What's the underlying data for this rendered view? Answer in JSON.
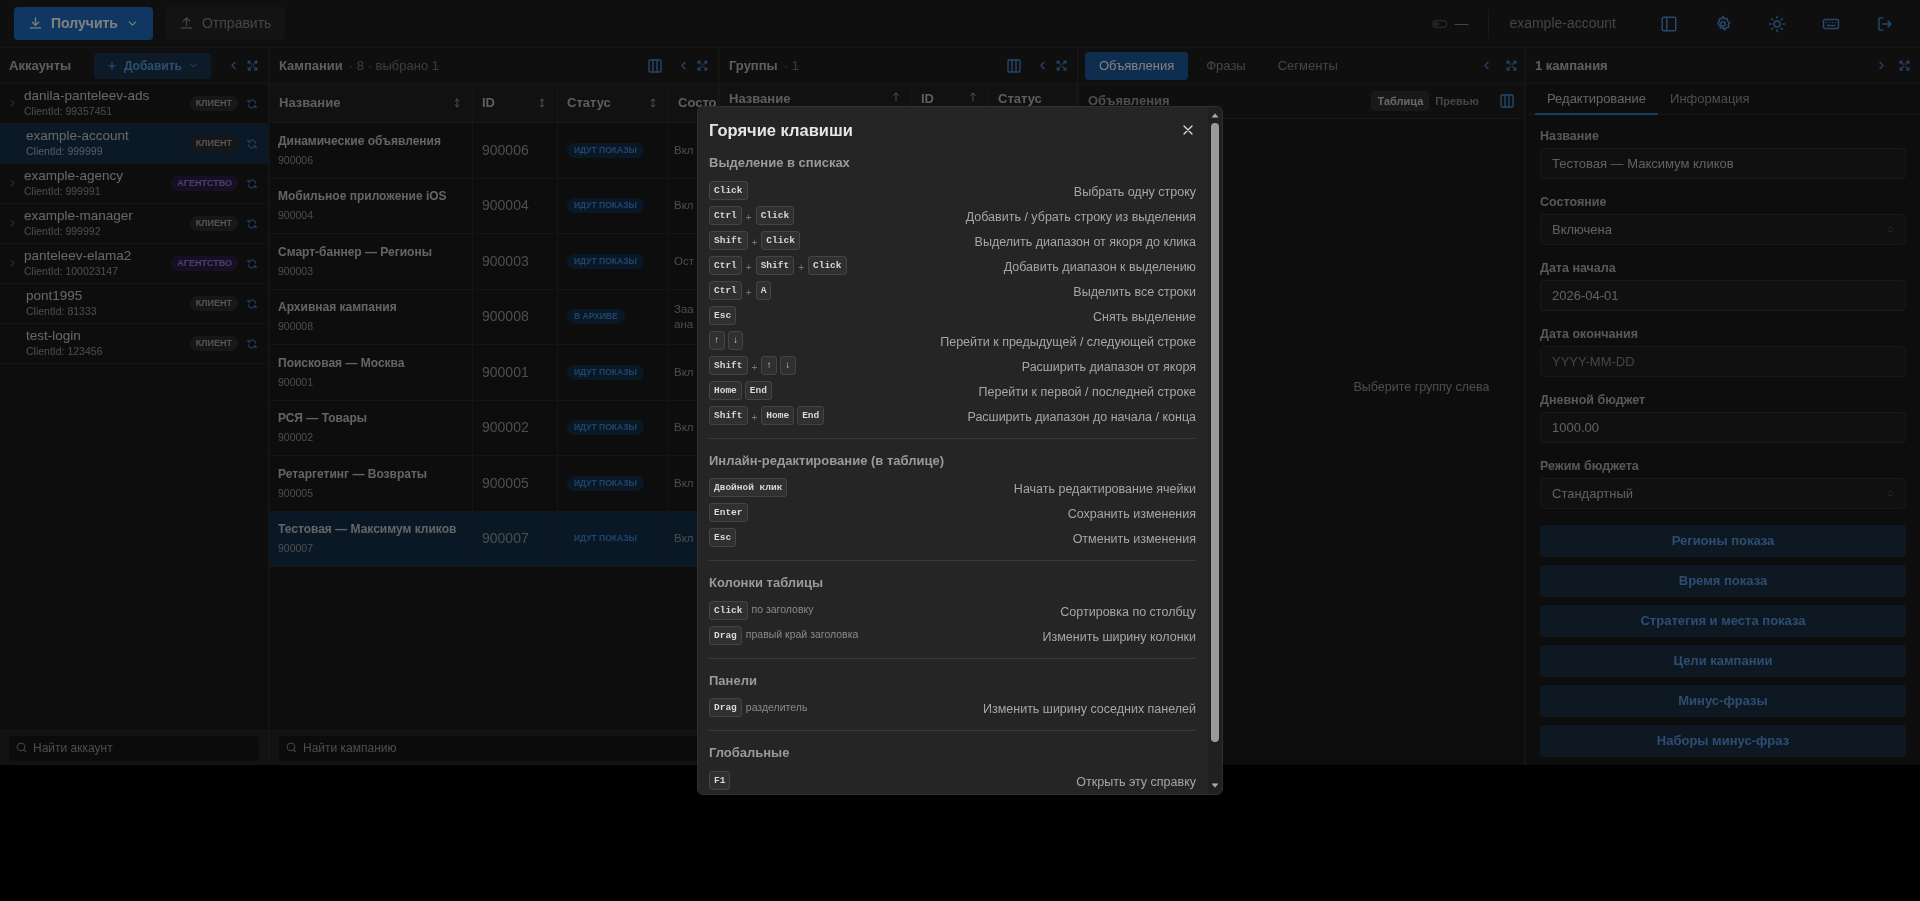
{
  "toolbar": {
    "fetch_button": "Получить",
    "send_button": "Отправить",
    "send_disabled": true,
    "status": "—",
    "account": "example-account"
  },
  "accounts": {
    "title": "Аккаунты",
    "add_button": "Добавить",
    "search_placeholder": "Найти аккаунт",
    "items": [
      {
        "name": "danila-panteleev-ads",
        "client_id": "ClientId: 99357451",
        "badge": "КЛИЕНТ",
        "kind": "client",
        "expandable": true,
        "selected": false
      },
      {
        "name": "example-account",
        "client_id": "ClientId: 999999",
        "badge": "КЛИЕНТ",
        "kind": "client",
        "expandable": false,
        "selected": true
      },
      {
        "name": "example-agency",
        "client_id": "ClientId: 999991",
        "badge": "АГЕНТСТВО",
        "kind": "agency",
        "expandable": true,
        "selected": false
      },
      {
        "name": "example-manager",
        "client_id": "ClientId: 999992",
        "badge": "КЛИЕНТ",
        "kind": "client",
        "expandable": true,
        "selected": false
      },
      {
        "name": "panteleev-elama2",
        "client_id": "ClientId: 100023147",
        "badge": "АГЕНТСТВО",
        "kind": "agency",
        "expandable": true,
        "selected": false
      },
      {
        "name": "pont1995",
        "client_id": "ClientId: 81333",
        "badge": "КЛИЕНТ",
        "kind": "client",
        "expandable": false,
        "selected": false
      },
      {
        "name": "test-login",
        "client_id": "ClientId: 123456",
        "badge": "КЛИЕНТ",
        "kind": "client",
        "expandable": false,
        "selected": false
      }
    ]
  },
  "campaigns": {
    "title": "Кампании",
    "meta": "· 8 · выбрано 1",
    "search_placeholder": "Найти кампанию",
    "columns": [
      {
        "label": "Название",
        "sortable": true,
        "sorted": false
      },
      {
        "label": "ID",
        "sortable": true,
        "sorted": false
      },
      {
        "label": "Статус",
        "sortable": true,
        "sorted": false
      },
      {
        "label": "Состо",
        "sortable": false
      }
    ],
    "rows": [
      {
        "name": "Динамические объявления",
        "sub": "900006",
        "id": "900006",
        "status": "ИДУТ ПОКАЗЫ",
        "state": "Вкл",
        "selected": false
      },
      {
        "name": "Мобильное приложение iOS",
        "sub": "900004",
        "id": "900004",
        "status": "ИДУТ ПОКАЗЫ",
        "state": "Вкл",
        "selected": false
      },
      {
        "name": "Смарт-баннер — Регионы",
        "sub": "900003",
        "id": "900003",
        "status": "ИДУТ ПОКАЗЫ",
        "state": "Ост",
        "selected": false
      },
      {
        "name": "Архивная кампания",
        "sub": "900008",
        "id": "900008",
        "status": "В АРХИВЕ",
        "state": "Заа ана",
        "selected": false
      },
      {
        "name": "Поисковая — Москва",
        "sub": "900001",
        "id": "900001",
        "status": "ИДУТ ПОКАЗЫ",
        "state": "Вкл",
        "selected": false
      },
      {
        "name": "РСЯ — Товары",
        "sub": "900002",
        "id": "900002",
        "status": "ИДУТ ПОКАЗЫ",
        "state": "Вкл",
        "selected": false
      },
      {
        "name": "Ретаргетинг — Возвраты",
        "sub": "900005",
        "id": "900005",
        "status": "ИДУТ ПОКАЗЫ",
        "state": "Вкл",
        "selected": false
      },
      {
        "name": "Тестовая — Максимум кликов",
        "sub": "900007",
        "id": "900007",
        "status": "ИДУТ ПОКАЗЫ",
        "state": "Вкл",
        "selected": true
      }
    ]
  },
  "groups": {
    "title": "Группы",
    "meta": "· 1",
    "columns": [
      {
        "label": "Название",
        "sortable": true,
        "sorted": true
      },
      {
        "label": "ID",
        "sortable": true,
        "sorted": true
      },
      {
        "label": "Статус",
        "sortable": false
      }
    ]
  },
  "ads": {
    "tabs": [
      {
        "label": "Объявления",
        "selected": true
      },
      {
        "label": "Фразы",
        "selected": false
      },
      {
        "label": "Сегменты",
        "selected": false
      }
    ],
    "subtitle": "Объявления",
    "views": [
      {
        "label": "Таблица",
        "selected": true
      },
      {
        "label": "Превью",
        "selected": false
      }
    ],
    "empty": "Выберите группу слева"
  },
  "editor": {
    "title": "1 кампания",
    "tabs": [
      {
        "label": "Редактирование",
        "selected": true
      },
      {
        "label": "Информация",
        "selected": false
      }
    ],
    "fields": [
      {
        "label": "Название",
        "kind": "text",
        "value": "Тестовая — Максимум кликов"
      },
      {
        "label": "Состояние",
        "kind": "select",
        "value": "Включена"
      },
      {
        "label": "Дата начала",
        "kind": "text",
        "value": "2026-04-01"
      },
      {
        "label": "Дата окончания",
        "kind": "text",
        "placeholder": "YYYY-MM-DD"
      },
      {
        "label": "Дневной бюджет",
        "kind": "text",
        "value": "1000.00"
      },
      {
        "label": "Режим бюджета",
        "kind": "select",
        "value": "Стандартный"
      }
    ],
    "buttons": [
      "Регионы показа",
      "Время показа",
      "Стратегия и места показа",
      "Цели кампании",
      "Минус-фразы",
      "Наборы минус-фраз"
    ]
  },
  "shortcuts": {
    "title": "Горячие клавиши",
    "sections": [
      {
        "title": "Выделение в списках",
        "rows": [
          {
            "keys": [
              {
                "kind": "key",
                "text": "Click"
              }
            ],
            "action": "Выбрать одну строку"
          },
          {
            "keys": [
              {
                "kind": "key",
                "text": "Ctrl"
              },
              {
                "kind": "plus",
                "text": "+"
              },
              {
                "kind": "key",
                "text": "Click"
              }
            ],
            "action": "Добавить / убрать строку из выделения"
          },
          {
            "keys": [
              {
                "kind": "key",
                "text": "Shift"
              },
              {
                "kind": "plus",
                "text": "+"
              },
              {
                "kind": "key",
                "text": "Click"
              }
            ],
            "action": "Выделить диапазон от якоря до клика"
          },
          {
            "keys": [
              {
                "kind": "key",
                "text": "Ctrl"
              },
              {
                "kind": "plus",
                "text": "+"
              },
              {
                "kind": "key",
                "text": "Shift"
              },
              {
                "kind": "plus",
                "text": "+"
              },
              {
                "kind": "key",
                "text": "Click"
              }
            ],
            "action": "Добавить диапазон к выделению"
          },
          {
            "keys": [
              {
                "kind": "key",
                "text": "Ctrl"
              },
              {
                "kind": "plus",
                "text": "+"
              },
              {
                "kind": "key",
                "text": "A"
              }
            ],
            "action": "Выделить все строки"
          },
          {
            "keys": [
              {
                "kind": "key",
                "text": "Esc"
              }
            ],
            "action": "Снять выделение"
          },
          {
            "keys": [
              {
                "kind": "key",
                "text": "↑"
              },
              {
                "kind": "key",
                "text": "↓"
              }
            ],
            "action": "Перейти к предыдущей / следующей строке"
          },
          {
            "keys": [
              {
                "kind": "key",
                "text": "Shift"
              },
              {
                "kind": "plus",
                "text": "+"
              },
              {
                "kind": "key",
                "text": "↑"
              },
              {
                "kind": "key",
                "text": "↓"
              }
            ],
            "action": "Расширить диапазон от якоря"
          },
          {
            "keys": [
              {
                "kind": "key",
                "text": "Home"
              },
              {
                "kind": "key",
                "text": "End"
              }
            ],
            "action": "Перейти к первой / последней строке"
          },
          {
            "keys": [
              {
                "kind": "key",
                "text": "Shift"
              },
              {
                "kind": "plus",
                "text": "+"
              },
              {
                "kind": "key",
                "text": "Home"
              },
              {
                "kind": "key",
                "text": "End"
              }
            ],
            "action": "Расширить диапазон до начала / конца"
          }
        ]
      },
      {
        "title": "Инлайн-редактирование (в таблице)",
        "rows": [
          {
            "keys": [
              {
                "kind": "key",
                "text": "Двойной клик"
              }
            ],
            "action": "Начать редактирование ячейки"
          },
          {
            "keys": [
              {
                "kind": "key",
                "text": "Enter"
              }
            ],
            "action": "Сохранить изменения"
          },
          {
            "keys": [
              {
                "kind": "key",
                "text": "Esc"
              }
            ],
            "action": "Отменить изменения"
          }
        ]
      },
      {
        "title": "Колонки таблицы",
        "rows": [
          {
            "keys": [
              {
                "kind": "key",
                "text": "Click"
              }
            ],
            "hint": "по заголовку",
            "action": "Сортировка по столбцу"
          },
          {
            "keys": [
              {
                "kind": "key",
                "text": "Drag"
              }
            ],
            "hint": "правый край заголовка",
            "action": "Изменить ширину колонки"
          }
        ]
      },
      {
        "title": "Панели",
        "rows": [
          {
            "keys": [
              {
                "kind": "key",
                "text": "Drag"
              }
            ],
            "hint": "разделитель",
            "action": "Изменить ширину соседних панелей"
          }
        ]
      },
      {
        "title": "Глобальные",
        "rows": [
          {
            "keys": [
              {
                "kind": "key",
                "text": "F1"
              }
            ],
            "action": "Открыть эту справку"
          }
        ]
      }
    ]
  }
}
